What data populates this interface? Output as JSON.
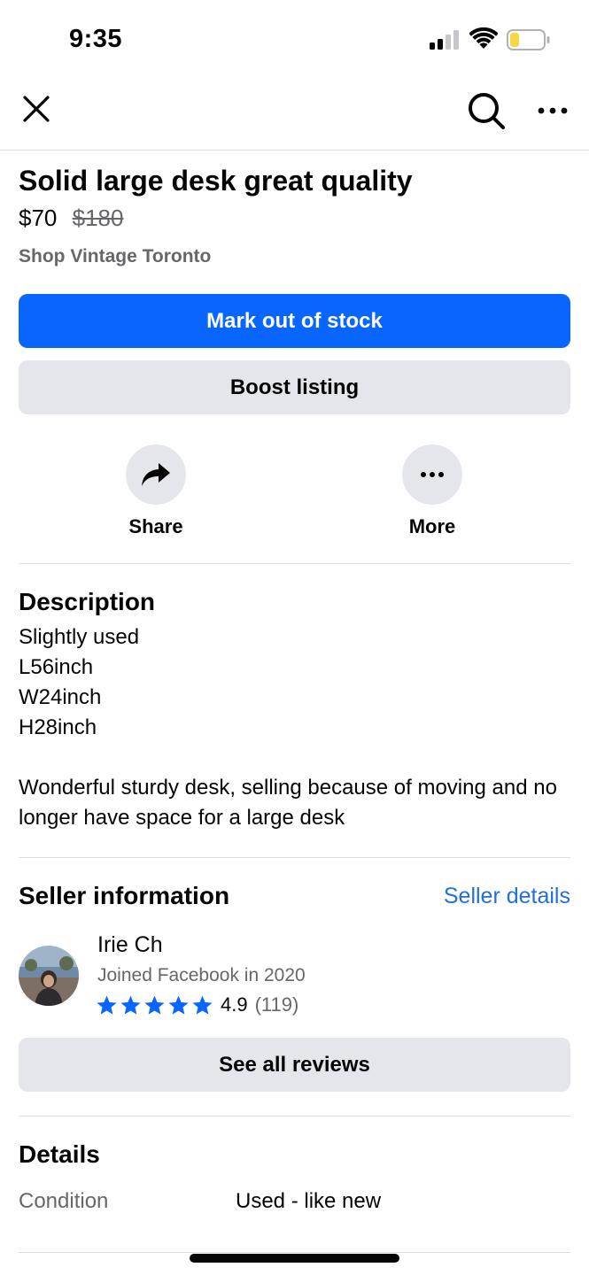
{
  "status_bar": {
    "time": "9:35"
  },
  "nav": {
    "close_icon": "close-icon",
    "search_icon": "search-icon",
    "more_icon": "more-horizontal-icon"
  },
  "listing": {
    "title": "Solid large desk great quality",
    "price": "$70",
    "original_price": "$180",
    "shop": "Shop Vintage Toronto"
  },
  "buttons": {
    "mark_out_of_stock": "Mark out of stock",
    "boost_listing": "Boost listing",
    "see_all_reviews": "See all reviews"
  },
  "actions": {
    "share_label": "Share",
    "more_label": "More"
  },
  "description": {
    "heading": "Description",
    "lines": [
      "Slightly used",
      "L56inch",
      "W24inch",
      "H28inch"
    ],
    "paragraph": "Wonderful sturdy desk, selling because of moving and no longer have space for a large desk"
  },
  "seller": {
    "heading": "Seller information",
    "details_link": "Seller details",
    "name": "Irie Ch",
    "joined": "Joined Facebook in 2020",
    "rating": "4.9",
    "review_count": "(119)",
    "stars": 5
  },
  "details": {
    "heading": "Details",
    "condition_label": "Condition",
    "condition_value": "Used - like new"
  },
  "colors": {
    "primary": "#0866ff",
    "secondary_bg": "#e4e6eb",
    "link": "#216fdb",
    "muted_text": "#65676b",
    "battery_fill": "#f7d64a"
  }
}
